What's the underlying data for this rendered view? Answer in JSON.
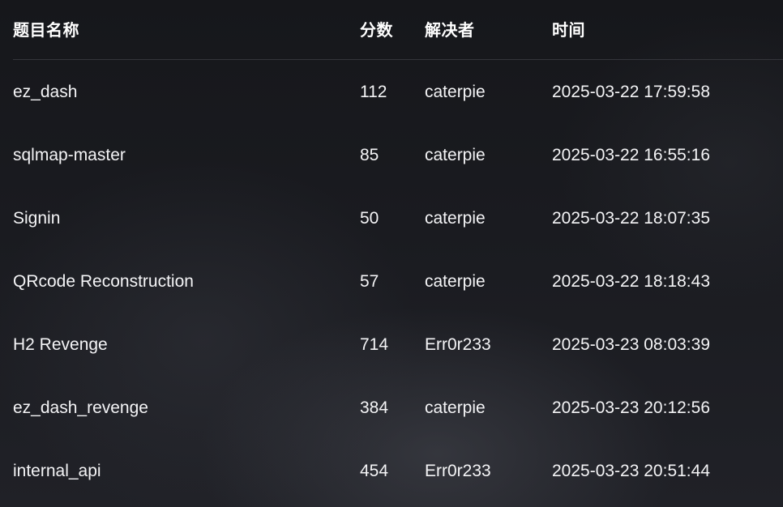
{
  "table": {
    "headers": {
      "name": "题目名称",
      "score": "分数",
      "solver": "解决者",
      "time": "时间"
    },
    "rows": [
      {
        "name": "ez_dash",
        "score": "112",
        "solver": "caterpie",
        "time": "2025-03-22 17:59:58"
      },
      {
        "name": "sqlmap-master",
        "score": "85",
        "solver": "caterpie",
        "time": "2025-03-22 16:55:16"
      },
      {
        "name": "Signin",
        "score": "50",
        "solver": "caterpie",
        "time": "2025-03-22 18:07:35"
      },
      {
        "name": "QRcode Reconstruction",
        "score": "57",
        "solver": "caterpie",
        "time": "2025-03-22 18:18:43"
      },
      {
        "name": "H2 Revenge",
        "score": "714",
        "solver": "Err0r233",
        "time": "2025-03-23 08:03:39"
      },
      {
        "name": "ez_dash_revenge",
        "score": "384",
        "solver": "caterpie",
        "time": "2025-03-23 20:12:56"
      },
      {
        "name": "internal_api",
        "score": "454",
        "solver": "Err0r233",
        "time": "2025-03-23 20:51:44"
      }
    ]
  }
}
